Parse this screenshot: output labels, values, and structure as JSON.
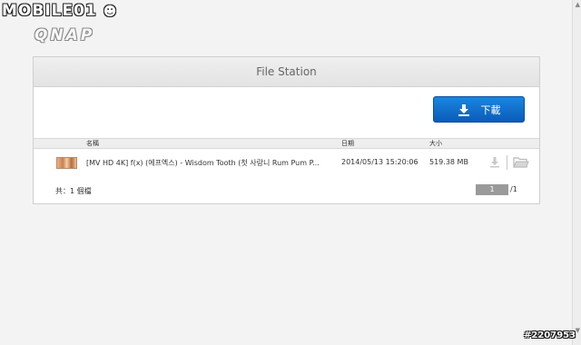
{
  "watermark": "MOBILE01",
  "brand": {
    "logo": "QNAP"
  },
  "panel": {
    "title": "File Station"
  },
  "toolbar": {
    "download_label": "下載"
  },
  "table": {
    "headers": {
      "name": "名稱",
      "date": "日期",
      "size": "大小"
    },
    "rows": [
      {
        "name": "[MV HD 4K] f(x) (에프엑스) - Wisdom Tooth (첫 사랑니 Rum Pum P...",
        "date": "2014/05/13 15:20:06",
        "size": "519.38 MB"
      }
    ]
  },
  "footer": {
    "total": "共：1 個檔",
    "current_page": "1",
    "total_pages": "/1"
  },
  "stamp": "#2207953",
  "colors": {
    "accent": "#0a6fd0",
    "header_bg": "#e9e9e9",
    "pager": "#9a9a9a"
  }
}
